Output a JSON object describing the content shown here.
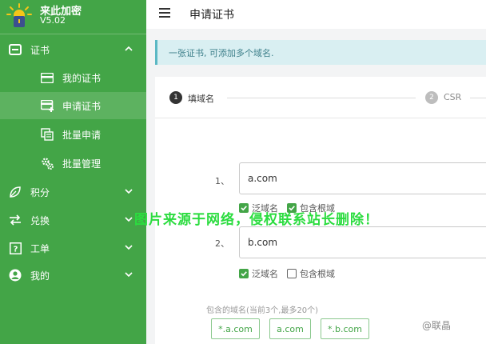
{
  "brand": {
    "name": "来此加密",
    "version": "V5.02"
  },
  "sidebar": {
    "items": [
      {
        "label": "证书",
        "icon": "certificate-icon",
        "expanded": true
      },
      {
        "label": "我的证书",
        "icon": "card-icon"
      },
      {
        "label": "申请证书",
        "icon": "card-add-icon",
        "active": true
      },
      {
        "label": "批量申请",
        "icon": "copy-icon"
      },
      {
        "label": "批量管理",
        "icon": "gears-icon"
      },
      {
        "label": "积分",
        "icon": "leaf-icon"
      },
      {
        "label": "兑换",
        "icon": "exchange-icon"
      },
      {
        "label": "工单",
        "icon": "question-box-icon"
      },
      {
        "label": "我的",
        "icon": "user-circle-icon"
      }
    ]
  },
  "header": {
    "title": "申请证书",
    "menu_icon": "hamburger-icon"
  },
  "alert": {
    "text": "一张证书, 可添加多个域名."
  },
  "stepper": {
    "steps": [
      {
        "number": "1",
        "label": "填域名",
        "active": true
      },
      {
        "number": "2",
        "label": "CSR",
        "active": false
      }
    ]
  },
  "domains": [
    {
      "index": "1、",
      "value": "a.com",
      "wildcard_label": "泛域名",
      "wildcard": true,
      "root_label": "包含根域",
      "root": true
    },
    {
      "index": "2、",
      "value": "b.com",
      "wildcard_label": "泛域名",
      "wildcard": true,
      "root_label": "包含根域",
      "root": false
    }
  ],
  "included": {
    "label": "包含的域名(当前3个,最多20个)",
    "chips": [
      "*.a.com",
      "a.com",
      "*.b.com"
    ]
  },
  "watermark": {
    "band": "图片来源于网络，侵权联系站长删除！",
    "corner": "@联晶"
  },
  "colors": {
    "sidebar": "#43a547",
    "active_item": "#5db260",
    "alert_bg": "#d9eff2",
    "alert_text": "#3d7f8a",
    "accent": "#43a547"
  }
}
